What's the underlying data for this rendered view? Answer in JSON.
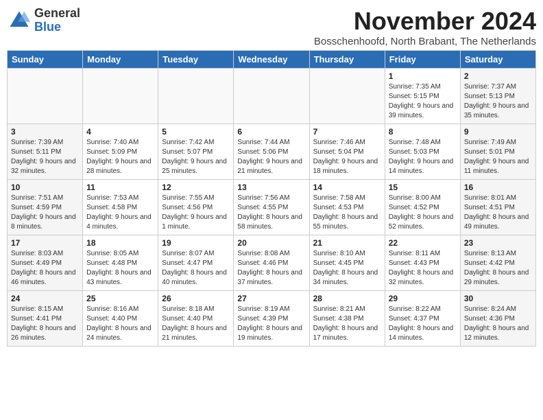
{
  "logo": {
    "general": "General",
    "blue": "Blue"
  },
  "title": "November 2024",
  "subtitle": "Bosschenhoofd, North Brabant, The Netherlands",
  "weekdays": [
    "Sunday",
    "Monday",
    "Tuesday",
    "Wednesday",
    "Thursday",
    "Friday",
    "Saturday"
  ],
  "weeks": [
    [
      {
        "day": "",
        "info": ""
      },
      {
        "day": "",
        "info": ""
      },
      {
        "day": "",
        "info": ""
      },
      {
        "day": "",
        "info": ""
      },
      {
        "day": "",
        "info": ""
      },
      {
        "day": "1",
        "info": "Sunrise: 7:35 AM\nSunset: 5:15 PM\nDaylight: 9 hours and 39 minutes."
      },
      {
        "day": "2",
        "info": "Sunrise: 7:37 AM\nSunset: 5:13 PM\nDaylight: 9 hours and 35 minutes."
      }
    ],
    [
      {
        "day": "3",
        "info": "Sunrise: 7:39 AM\nSunset: 5:11 PM\nDaylight: 9 hours and 32 minutes."
      },
      {
        "day": "4",
        "info": "Sunrise: 7:40 AM\nSunset: 5:09 PM\nDaylight: 9 hours and 28 minutes."
      },
      {
        "day": "5",
        "info": "Sunrise: 7:42 AM\nSunset: 5:07 PM\nDaylight: 9 hours and 25 minutes."
      },
      {
        "day": "6",
        "info": "Sunrise: 7:44 AM\nSunset: 5:06 PM\nDaylight: 9 hours and 21 minutes."
      },
      {
        "day": "7",
        "info": "Sunrise: 7:46 AM\nSunset: 5:04 PM\nDaylight: 9 hours and 18 minutes."
      },
      {
        "day": "8",
        "info": "Sunrise: 7:48 AM\nSunset: 5:03 PM\nDaylight: 9 hours and 14 minutes."
      },
      {
        "day": "9",
        "info": "Sunrise: 7:49 AM\nSunset: 5:01 PM\nDaylight: 9 hours and 11 minutes."
      }
    ],
    [
      {
        "day": "10",
        "info": "Sunrise: 7:51 AM\nSunset: 4:59 PM\nDaylight: 9 hours and 8 minutes."
      },
      {
        "day": "11",
        "info": "Sunrise: 7:53 AM\nSunset: 4:58 PM\nDaylight: 9 hours and 4 minutes."
      },
      {
        "day": "12",
        "info": "Sunrise: 7:55 AM\nSunset: 4:56 PM\nDaylight: 9 hours and 1 minute."
      },
      {
        "day": "13",
        "info": "Sunrise: 7:56 AM\nSunset: 4:55 PM\nDaylight: 8 hours and 58 minutes."
      },
      {
        "day": "14",
        "info": "Sunrise: 7:58 AM\nSunset: 4:53 PM\nDaylight: 8 hours and 55 minutes."
      },
      {
        "day": "15",
        "info": "Sunrise: 8:00 AM\nSunset: 4:52 PM\nDaylight: 8 hours and 52 minutes."
      },
      {
        "day": "16",
        "info": "Sunrise: 8:01 AM\nSunset: 4:51 PM\nDaylight: 8 hours and 49 minutes."
      }
    ],
    [
      {
        "day": "17",
        "info": "Sunrise: 8:03 AM\nSunset: 4:49 PM\nDaylight: 8 hours and 46 minutes."
      },
      {
        "day": "18",
        "info": "Sunrise: 8:05 AM\nSunset: 4:48 PM\nDaylight: 8 hours and 43 minutes."
      },
      {
        "day": "19",
        "info": "Sunrise: 8:07 AM\nSunset: 4:47 PM\nDaylight: 8 hours and 40 minutes."
      },
      {
        "day": "20",
        "info": "Sunrise: 8:08 AM\nSunset: 4:46 PM\nDaylight: 8 hours and 37 minutes."
      },
      {
        "day": "21",
        "info": "Sunrise: 8:10 AM\nSunset: 4:45 PM\nDaylight: 8 hours and 34 minutes."
      },
      {
        "day": "22",
        "info": "Sunrise: 8:11 AM\nSunset: 4:43 PM\nDaylight: 8 hours and 32 minutes."
      },
      {
        "day": "23",
        "info": "Sunrise: 8:13 AM\nSunset: 4:42 PM\nDaylight: 8 hours and 29 minutes."
      }
    ],
    [
      {
        "day": "24",
        "info": "Sunrise: 8:15 AM\nSunset: 4:41 PM\nDaylight: 8 hours and 26 minutes."
      },
      {
        "day": "25",
        "info": "Sunrise: 8:16 AM\nSunset: 4:40 PM\nDaylight: 8 hours and 24 minutes."
      },
      {
        "day": "26",
        "info": "Sunrise: 8:18 AM\nSunset: 4:40 PM\nDaylight: 8 hours and 21 minutes."
      },
      {
        "day": "27",
        "info": "Sunrise: 8:19 AM\nSunset: 4:39 PM\nDaylight: 8 hours and 19 minutes."
      },
      {
        "day": "28",
        "info": "Sunrise: 8:21 AM\nSunset: 4:38 PM\nDaylight: 8 hours and 17 minutes."
      },
      {
        "day": "29",
        "info": "Sunrise: 8:22 AM\nSunset: 4:37 PM\nDaylight: 8 hours and 14 minutes."
      },
      {
        "day": "30",
        "info": "Sunrise: 8:24 AM\nSunset: 4:36 PM\nDaylight: 8 hours and 12 minutes."
      }
    ]
  ]
}
